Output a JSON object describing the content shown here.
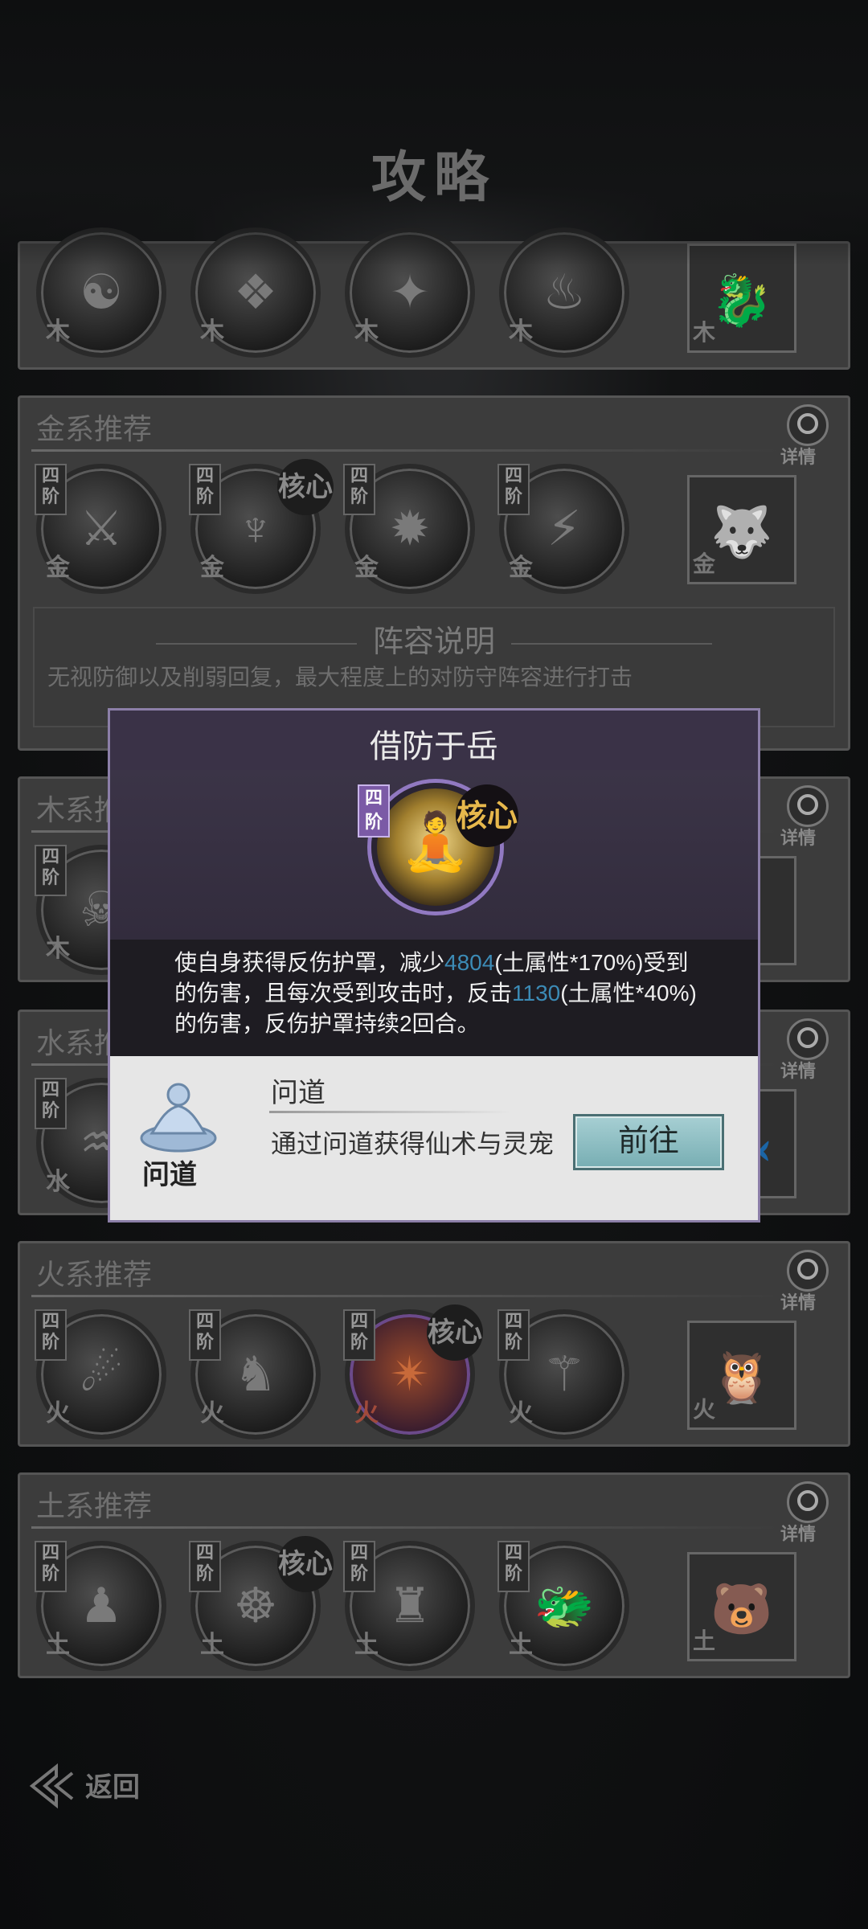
{
  "header": {
    "title": "攻略"
  },
  "common": {
    "tier": "四阶",
    "core": "核心",
    "detail": "详情"
  },
  "groups": [
    {
      "key": "wood_top",
      "title": "",
      "element": "木"
    },
    {
      "key": "metal",
      "title": "金系推荐",
      "element": "金"
    },
    {
      "key": "wood",
      "title": "木系推荐",
      "element": "木"
    },
    {
      "key": "water",
      "title": "水系推荐",
      "element": "水"
    },
    {
      "key": "fire",
      "title": "火系推荐",
      "element": "火"
    },
    {
      "key": "earth",
      "title": "土系推荐",
      "element": "土"
    }
  ],
  "lineup": {
    "title": "阵容说明",
    "description": "无视防御以及削弱回复，最大程度上的对防守阵容进行打击"
  },
  "modal": {
    "title": "借防于岳",
    "tier": "四阶",
    "core": "核心",
    "description": {
      "p1": "使自身获得反伤护罩，减少",
      "v1": "4804",
      "p2": "(土属性*170%)受到的伤害，且每次受到攻击时，反击",
      "v2": "1130",
      "p3": "(土属性*40%)的伤害，反伤护罩持续2回合。"
    },
    "source": {
      "icon": "meditation-icon",
      "label": "问道",
      "name": "问道",
      "description": "通过问道获得仙术与灵宠",
      "button": "前往"
    }
  },
  "footer": {
    "back": "返回"
  },
  "colors": {
    "highlight": "#3c8bb6",
    "modal_border": "#8c7fa8",
    "button": "#8fc0c4"
  }
}
